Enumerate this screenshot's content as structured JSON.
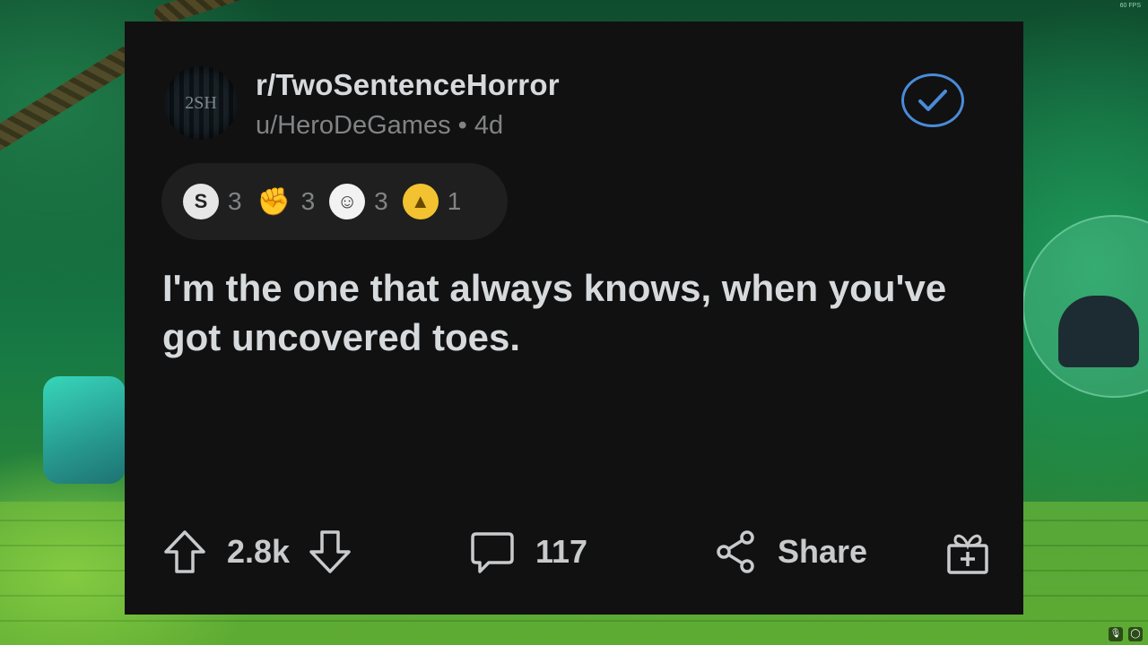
{
  "post": {
    "subreddit": "r/TwoSentenceHorror",
    "avatar_text": "2SH",
    "meta": "u/HeroDeGames • 4d",
    "body": "I'm the one that always knows, when you've got uncovered toes."
  },
  "awards": [
    {
      "icon": "silver-award-icon",
      "glyph": "S",
      "count": "3"
    },
    {
      "icon": "helpful-hands-award-icon",
      "glyph": "✊",
      "count": "3"
    },
    {
      "icon": "wholesome-award-icon",
      "glyph": "☺",
      "count": "3"
    },
    {
      "icon": "gold-pyramid-award-icon",
      "glyph": "▲",
      "count": "1"
    }
  ],
  "footer": {
    "votes": "2.8k",
    "comments": "117",
    "share_label": "Share"
  },
  "overlay": {
    "fps": "60 FPS"
  },
  "colors": {
    "card_bg": "#111112",
    "check_accent": "#4a8bd8",
    "text_primary": "#d7dadc",
    "text_secondary": "#818384"
  }
}
